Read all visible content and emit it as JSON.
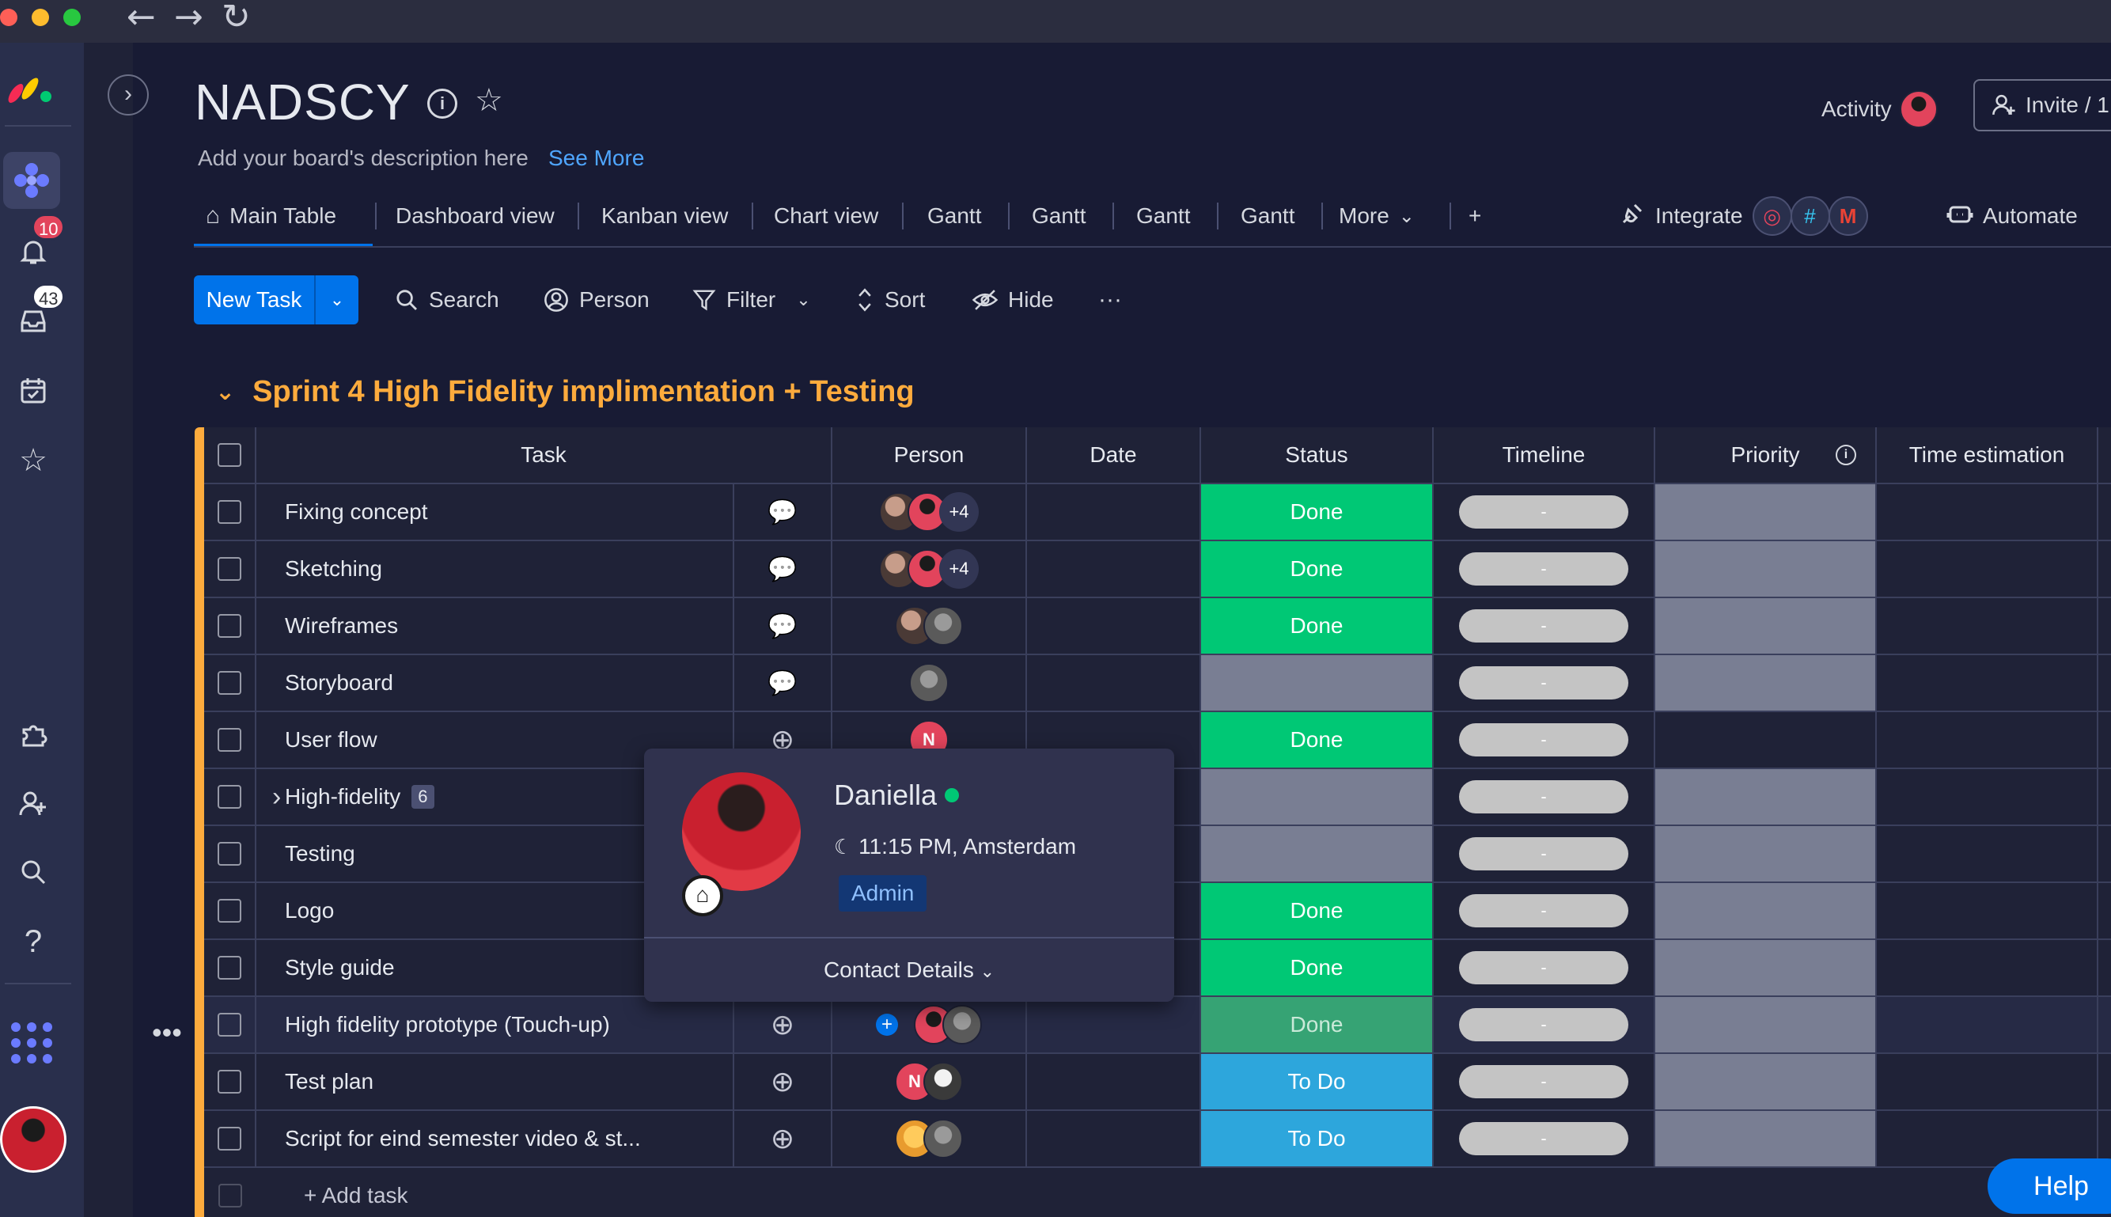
{
  "board": {
    "title": "NADSCY",
    "description": "Add your board's description here",
    "see_more": "See More"
  },
  "header": {
    "activity": "Activity",
    "invite": "Invite / 1"
  },
  "notifications": {
    "bell_count": "10",
    "inbox_count": "43"
  },
  "tabs": [
    {
      "label": "Main Table"
    },
    {
      "label": "Dashboard view"
    },
    {
      "label": "Kanban view"
    },
    {
      "label": "Chart view"
    },
    {
      "label": "Gantt"
    },
    {
      "label": "Gantt"
    },
    {
      "label": "Gantt"
    },
    {
      "label": "Gantt"
    },
    {
      "label": "More"
    },
    {
      "label": "+"
    }
  ],
  "integrations": {
    "integrate": "Integrate",
    "automate": "Automate"
  },
  "toolbar": {
    "new_task": "New Task",
    "search": "Search",
    "person": "Person",
    "filter": "Filter",
    "sort": "Sort",
    "hide": "Hide",
    "more": "···"
  },
  "group": {
    "title": "Sprint 4 High Fidelity implimentation + Testing",
    "columns": [
      "Task",
      "Person",
      "Date",
      "Status",
      "Timeline",
      "Priority",
      "Time estimation"
    ],
    "rows": [
      {
        "task": "Fixing concept",
        "status": "Done",
        "timeline": "-",
        "persons_extra": "+4"
      },
      {
        "task": "Sketching",
        "status": "Done",
        "timeline": "-",
        "persons_extra": "+4"
      },
      {
        "task": "Wireframes",
        "status": "Done",
        "timeline": "-"
      },
      {
        "task": "Storyboard",
        "status": "",
        "timeline": "-"
      },
      {
        "task": "User flow",
        "status": "Done",
        "timeline": "-",
        "person_initial": "N"
      },
      {
        "task": "High-fidelity",
        "status": "",
        "timeline": "-",
        "subitems": "6"
      },
      {
        "task": "Testing",
        "status": "",
        "timeline": "-"
      },
      {
        "task": "Logo",
        "status": "Done",
        "timeline": "-"
      },
      {
        "task": "Style guide",
        "status": "Done",
        "timeline": "-"
      },
      {
        "task": "High fidelity prototype (Touch-up)",
        "status": "Done",
        "timeline": "-"
      },
      {
        "task": "Test plan",
        "status": "To Do",
        "timeline": "-",
        "person_initial": "N"
      },
      {
        "task": "Script for eind semester video & st...",
        "status": "To Do",
        "timeline": "-"
      }
    ],
    "add_task": "+ Add task"
  },
  "popup": {
    "name": "Daniella",
    "time": "11:15 PM, Amsterdam",
    "role": "Admin",
    "contact": "Contact Details"
  },
  "help": "Help",
  "colors": {
    "accent": "#0073ea",
    "done": "#00c875",
    "todo": "#2da6dc",
    "group": "#fdab3d",
    "empty_status": "#797e93"
  }
}
